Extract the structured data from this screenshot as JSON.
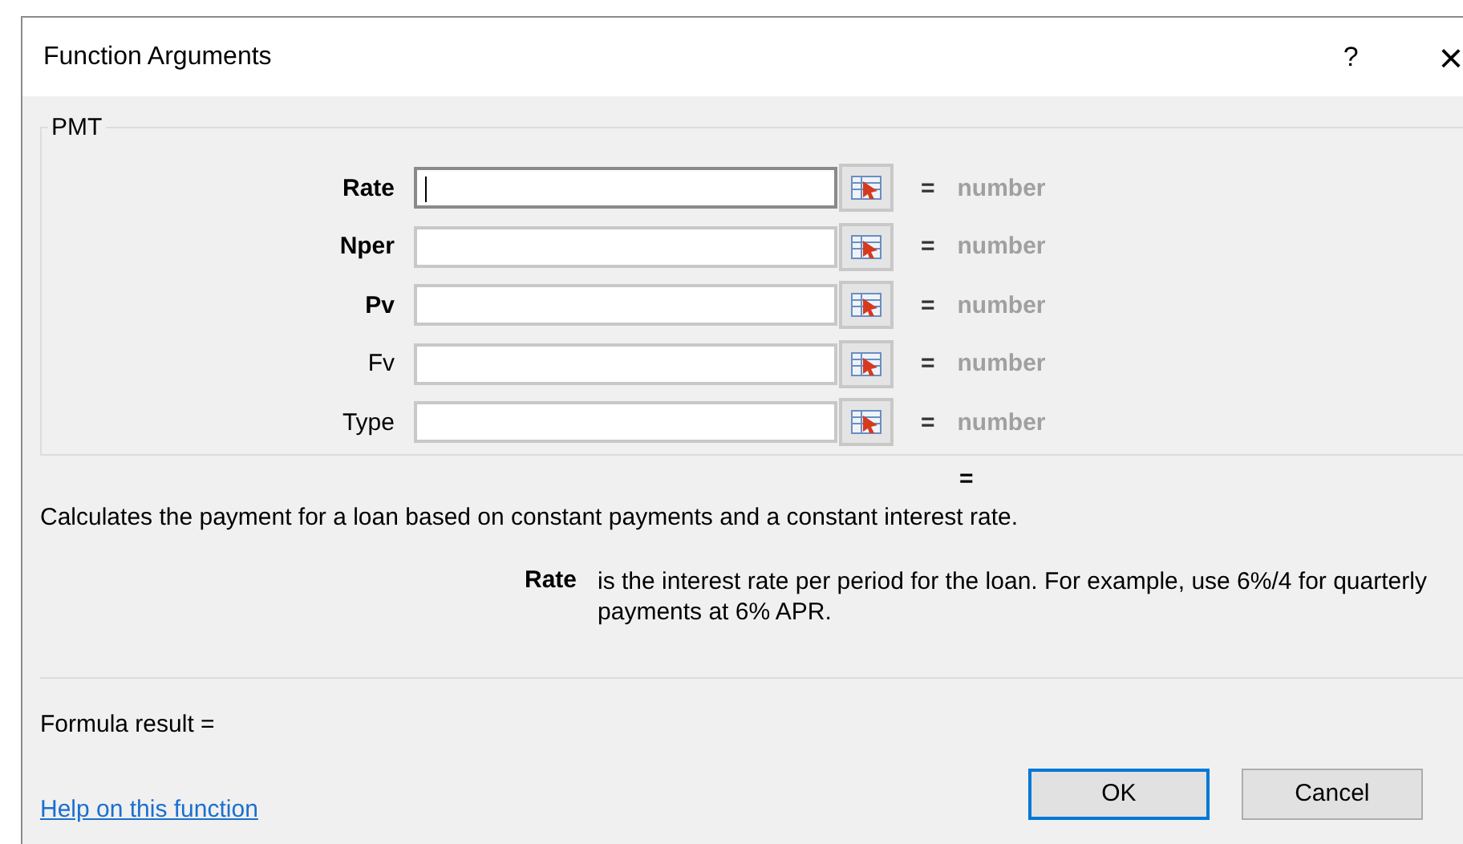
{
  "window": {
    "title": "Function Arguments",
    "help_button": "?",
    "close_button": "×"
  },
  "group": {
    "title": "PMT"
  },
  "arguments": [
    {
      "label": "Rate",
      "required": true,
      "focused": true,
      "result": "number"
    },
    {
      "label": "Nper",
      "required": true,
      "focused": false,
      "result": "number"
    },
    {
      "label": "Pv",
      "required": true,
      "focused": false,
      "result": "number"
    },
    {
      "label": "Fv",
      "required": false,
      "focused": false,
      "result": "number"
    },
    {
      "label": "Type",
      "required": false,
      "focused": false,
      "result": "number"
    }
  ],
  "equals_sign": "=",
  "function_result": "=",
  "description": "Calculates the payment for a loan based on constant payments and a constant interest rate.",
  "argument_help": {
    "name": "Rate",
    "text": "is the interest rate per period for the loan. For example, use 6%/4 for quarterly payments at 6% APR."
  },
  "formula_result": "Formula result =",
  "help_link": "Help on this function",
  "buttons": [
    {
      "label": "OK",
      "default": true
    },
    {
      "label": "Cancel",
      "default": false
    }
  ]
}
